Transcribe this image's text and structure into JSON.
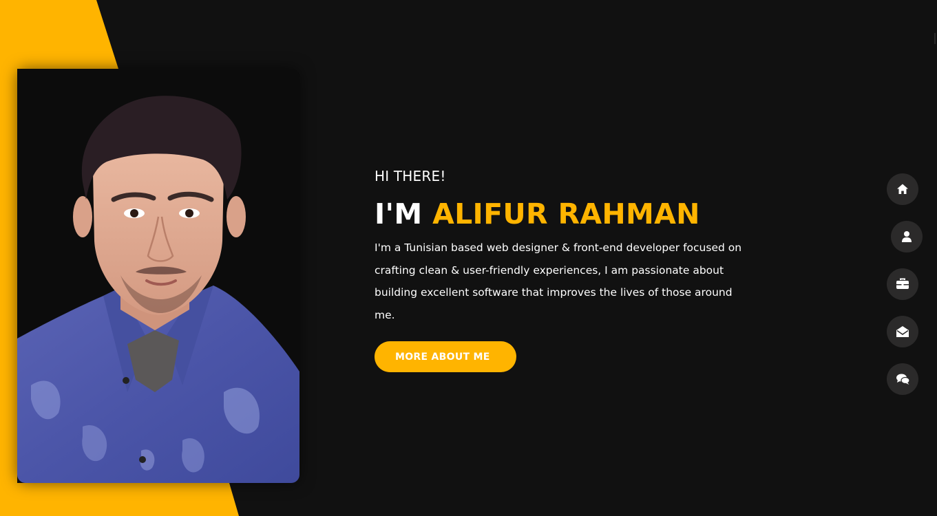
{
  "hero": {
    "greeting": "HI THERE!",
    "heading_prefix": "I'M ",
    "heading_name": "ALIFUR RAHMAN",
    "intro": "I'm a Tunisian based web designer & front-end developer focused on crafting clean & user-friendly experiences, I am passionate about building excellent software that improves the lives of those around me.",
    "cta_label": "MORE ABOUT ME"
  },
  "nav": {
    "items": [
      {
        "icon": "home-icon"
      },
      {
        "icon": "user-icon"
      },
      {
        "icon": "briefcase-icon"
      },
      {
        "icon": "envelope-open-icon"
      },
      {
        "icon": "comments-icon"
      }
    ]
  },
  "colors": {
    "accent": "#ffb400",
    "background": "#111111",
    "nav_button": "#2b2a2a"
  }
}
